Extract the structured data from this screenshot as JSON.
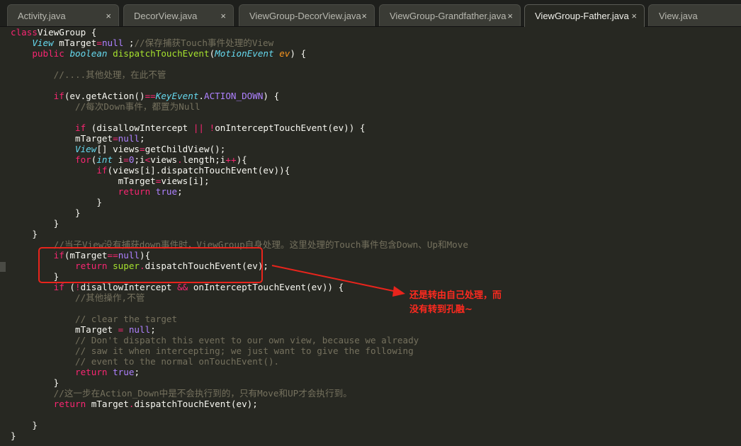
{
  "tabs": [
    {
      "label": "Activity.java",
      "active": false
    },
    {
      "label": "DecorView.java",
      "active": false
    },
    {
      "label": "ViewGroup-DecorView.java",
      "active": false
    },
    {
      "label": "ViewGroup-Grandfather.java",
      "active": false
    },
    {
      "label": "ViewGroup-Father.java",
      "active": true
    },
    {
      "label": "View.java",
      "active": false
    }
  ],
  "close_glyph": "×",
  "code_lines": [
    [
      [
        "kw",
        "class"
      ],
      [
        "",
        "ViewGroup {"
      ]
    ],
    [
      [
        "",
        "    "
      ],
      [
        "ty",
        "View"
      ],
      [
        "",
        " mTarget"
      ],
      [
        "kw",
        "="
      ],
      [
        "cn",
        "null"
      ],
      [
        "",
        " ;"
      ],
      [
        "cm",
        "//保存捕获Touch事件处理的View"
      ]
    ],
    [
      [
        "",
        "    "
      ],
      [
        "kw",
        "public"
      ],
      [
        "",
        " "
      ],
      [
        "ty",
        "boolean"
      ],
      [
        "",
        " "
      ],
      [
        "fn",
        "dispatchTouchEvent"
      ],
      [
        "",
        "("
      ],
      [
        "ty",
        "MotionEvent"
      ],
      [
        "",
        " "
      ],
      [
        "pa",
        "ev"
      ],
      [
        "",
        ") {"
      ]
    ],
    [
      [
        "",
        ""
      ]
    ],
    [
      [
        "",
        "        "
      ],
      [
        "cm",
        "//....其他处理，在此不管"
      ]
    ],
    [
      [
        "",
        ""
      ]
    ],
    [
      [
        "",
        "        "
      ],
      [
        "kw",
        "if"
      ],
      [
        "",
        "(ev.getAction()"
      ],
      [
        "kw",
        "=="
      ],
      [
        "ty",
        "KeyEvent"
      ],
      [
        "",
        "."
      ],
      [
        "cn",
        "ACTION_DOWN"
      ],
      [
        "",
        ")",
        " "
      ],
      [
        "",
        "{"
      ]
    ],
    [
      [
        "",
        "            "
      ],
      [
        "cm",
        "//每次Down事件，都置为Null"
      ]
    ],
    [
      [
        "",
        ""
      ]
    ],
    [
      [
        "",
        "            "
      ],
      [
        "kw",
        "if"
      ],
      [
        "",
        " (disallowIntercept "
      ],
      [
        "kw",
        "||"
      ],
      [
        "",
        " "
      ],
      [
        "kw",
        "!"
      ],
      [
        "",
        "onInterceptTouchEvent(ev)) {"
      ]
    ],
    [
      [
        "",
        "            mTarget"
      ],
      [
        "kw",
        "="
      ],
      [
        "cn",
        "null"
      ],
      [
        "",
        ";"
      ]
    ],
    [
      [
        "",
        "            "
      ],
      [
        "ty",
        "View"
      ],
      [
        "",
        "[] views"
      ],
      [
        "kw",
        "="
      ],
      [
        "",
        "getChildView();"
      ]
    ],
    [
      [
        "",
        "            "
      ],
      [
        "kw",
        "for"
      ],
      [
        "",
        "("
      ],
      [
        "ty",
        "int"
      ],
      [
        "",
        " i"
      ],
      [
        "kw",
        "="
      ],
      [
        "cn",
        "0"
      ],
      [
        "",
        ";i"
      ],
      [
        "kw",
        "<"
      ],
      [
        "",
        "views"
      ],
      [
        "kw",
        "."
      ],
      [
        "",
        "length;i"
      ],
      [
        "kw",
        "++"
      ],
      [
        "",
        "){"
      ]
    ],
    [
      [
        "",
        "                "
      ],
      [
        "kw",
        "if"
      ],
      [
        "",
        "(views[i].dispatchTouchEvent(ev)){"
      ]
    ],
    [
      [
        "",
        "                    mTarget"
      ],
      [
        "kw",
        "="
      ],
      [
        "",
        "views[i];"
      ]
    ],
    [
      [
        "",
        "                    "
      ],
      [
        "kw",
        "return"
      ],
      [
        "",
        " "
      ],
      [
        "cn",
        "true"
      ],
      [
        "",
        ";"
      ]
    ],
    [
      [
        "",
        "                }"
      ]
    ],
    [
      [
        "",
        "            }"
      ]
    ],
    [
      [
        "",
        "        }"
      ]
    ],
    [
      [
        "",
        "    }"
      ]
    ],
    [
      [
        "",
        "        "
      ],
      [
        "cm",
        "//当子View没有捕获down事件时，ViewGroup自身处理。这里处理的Touch事件包含Down、Up和Move"
      ]
    ],
    [
      [
        "",
        "        "
      ],
      [
        "kw",
        "if"
      ],
      [
        "",
        "(mTarget"
      ],
      [
        "kw",
        "=="
      ],
      [
        "cn",
        "null"
      ],
      [
        "",
        "){"
      ]
    ],
    [
      [
        "",
        "            "
      ],
      [
        "kw",
        "return"
      ],
      [
        "",
        " "
      ],
      [
        "fn",
        "super"
      ],
      [
        "kw",
        "."
      ],
      [
        "",
        "dispatchTouchEvent(ev);"
      ]
    ],
    [
      [
        "",
        "        }"
      ]
    ],
    [
      [
        "",
        "        "
      ],
      [
        "kw",
        "if"
      ],
      [
        "",
        " ("
      ],
      [
        "kw",
        "!"
      ],
      [
        "",
        "disallowIntercept "
      ],
      [
        "kw",
        "&&"
      ],
      [
        "",
        " onInterceptTouchEvent(ev)) {"
      ]
    ],
    [
      [
        "",
        "            "
      ],
      [
        "cm",
        "//其他操作,不管"
      ]
    ],
    [
      [
        "",
        ""
      ]
    ],
    [
      [
        "",
        "            "
      ],
      [
        "cm",
        "// clear the target"
      ]
    ],
    [
      [
        "",
        "            mTarget "
      ],
      [
        "kw",
        "="
      ],
      [
        "",
        " "
      ],
      [
        "cn",
        "null"
      ],
      [
        "",
        ";"
      ]
    ],
    [
      [
        "",
        "            "
      ],
      [
        "cm",
        "// Don't dispatch this event to our own view, because we already"
      ]
    ],
    [
      [
        "",
        "            "
      ],
      [
        "cm",
        "// saw it when intercepting; we just want to give the following"
      ]
    ],
    [
      [
        "",
        "            "
      ],
      [
        "cm",
        "// event to the normal onTouchEvent()."
      ]
    ],
    [
      [
        "",
        "            "
      ],
      [
        "kw",
        "return"
      ],
      [
        "",
        " "
      ],
      [
        "cn",
        "true"
      ],
      [
        "",
        ";"
      ]
    ],
    [
      [
        "",
        "        }"
      ]
    ],
    [
      [
        "",
        "        "
      ],
      [
        "cm",
        "//这一步在Action_Down中是不会执行到的，只有Move和UP才会执行到。"
      ]
    ],
    [
      [
        "",
        "        "
      ],
      [
        "kw",
        "return"
      ],
      [
        "",
        " mTarget"
      ],
      [
        "kw",
        "."
      ],
      [
        "",
        "dispatchTouchEvent(ev);"
      ]
    ],
    [
      [
        "",
        ""
      ]
    ],
    [
      [
        "",
        "    }"
      ]
    ],
    [
      [
        "",
        "}"
      ]
    ]
  ],
  "annotation": {
    "line1": "还是转由自己处理，而",
    "line2": "没有转到孔融~"
  },
  "colors": {
    "keyword": "#f92672",
    "type": "#66d9ef",
    "function": "#a6e22e",
    "param": "#fd971f",
    "constant": "#ae81ff",
    "comment": "#75715e",
    "annotation": "#ff2a1f"
  }
}
